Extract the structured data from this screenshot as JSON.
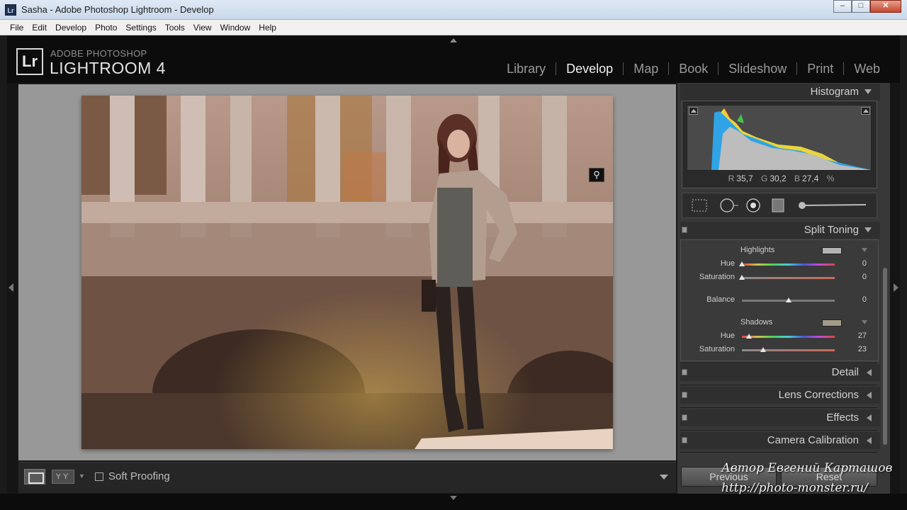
{
  "window": {
    "app_icon": "Lr",
    "title": "Sasha - Adobe Photoshop Lightroom - Develop",
    "minimize": "–",
    "maximize": "□",
    "close": "✕"
  },
  "menu": [
    "File",
    "Edit",
    "Develop",
    "Photo",
    "Settings",
    "Tools",
    "View",
    "Window",
    "Help"
  ],
  "brand": {
    "logo": "Lr",
    "line1": "ADOBE PHOTOSHOP",
    "line2": "LIGHTROOM 4"
  },
  "modules": [
    {
      "label": "Library",
      "active": false
    },
    {
      "label": "Develop",
      "active": true
    },
    {
      "label": "Map",
      "active": false
    },
    {
      "label": "Book",
      "active": false
    },
    {
      "label": "Slideshow",
      "active": false
    },
    {
      "label": "Print",
      "active": false
    },
    {
      "label": "Web",
      "active": false
    }
  ],
  "histogram": {
    "title": "Histogram",
    "r_label": "R",
    "r_value": "35,7",
    "g_label": "G",
    "g_value": "30,2",
    "b_label": "B",
    "b_value": "27,4",
    "unit": "%"
  },
  "split_toning": {
    "title": "Split Toning",
    "highlights": {
      "label": "Highlights",
      "swatch_color": "#b3b3b3",
      "hue_label": "Hue",
      "hue": 0,
      "sat_label": "Saturation",
      "saturation": 0
    },
    "balance": {
      "label": "Balance",
      "value": 0
    },
    "shadows": {
      "label": "Shadows",
      "swatch_color": "#a39a88",
      "hue_label": "Hue",
      "hue": 27,
      "sat_label": "Saturation",
      "saturation": 23
    }
  },
  "panels": [
    "Detail",
    "Lens Corrections",
    "Effects",
    "Camera Calibration"
  ],
  "toolbar": {
    "soft_proofing": "Soft Proofing",
    "yy": "YY"
  },
  "buttons": {
    "previous": "Previous",
    "reset": "Reset"
  },
  "watermark": {
    "line1": "Автор Евгений Карташов",
    "line2": "http://photo-monster.ru/"
  },
  "icons": {
    "zoom": "magnifier-icon",
    "view": "loupe-view-icon",
    "crop": "crop-overlay-icon",
    "spot": "spot-removal-icon",
    "redeye": "red-eye-icon",
    "grad": "graduated-filter-icon",
    "brush": "adjustment-brush-icon"
  }
}
